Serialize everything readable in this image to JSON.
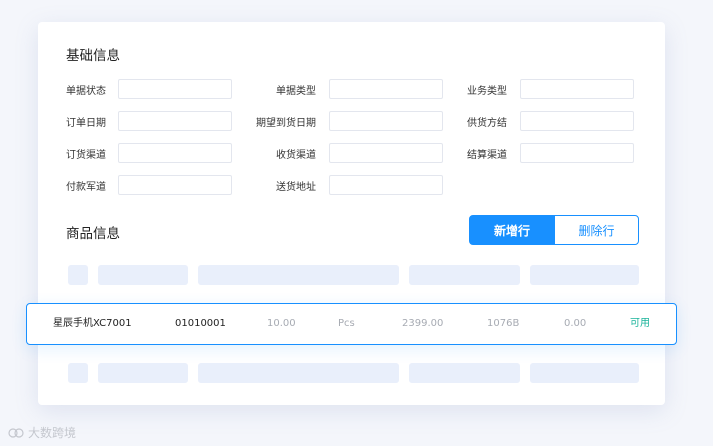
{
  "basic_info": {
    "title": "基础信息",
    "fields": [
      {
        "label": "单据状态",
        "value": ""
      },
      {
        "label": "单据类型",
        "value": ""
      },
      {
        "label": "业务类型",
        "value": ""
      },
      {
        "label": "订单日期",
        "value": ""
      },
      {
        "label": "期望到货日期",
        "value": ""
      },
      {
        "label": "供货方结",
        "value": ""
      },
      {
        "label": "订货渠道",
        "value": ""
      },
      {
        "label": "收货渠道",
        "value": ""
      },
      {
        "label": "结算渠道",
        "value": ""
      },
      {
        "label": "付款军道",
        "value": ""
      },
      {
        "label": "送货地址",
        "value": ""
      }
    ]
  },
  "product_info": {
    "title": "商品信息",
    "add_row_label": "新增行",
    "delete_row_label": "删除行",
    "row": {
      "name": "星辰手机XC7001",
      "code": "01010001",
      "quantity": "10.00",
      "unit": "Pcs",
      "price": "2399.00",
      "spec": "1076B",
      "discount": "0.00",
      "status": "可用"
    }
  },
  "watermark": {
    "text": "大数跨境"
  },
  "colors": {
    "accent": "#1890ff",
    "status_ok": "#19b39a",
    "skeleton": "#e9effb"
  }
}
